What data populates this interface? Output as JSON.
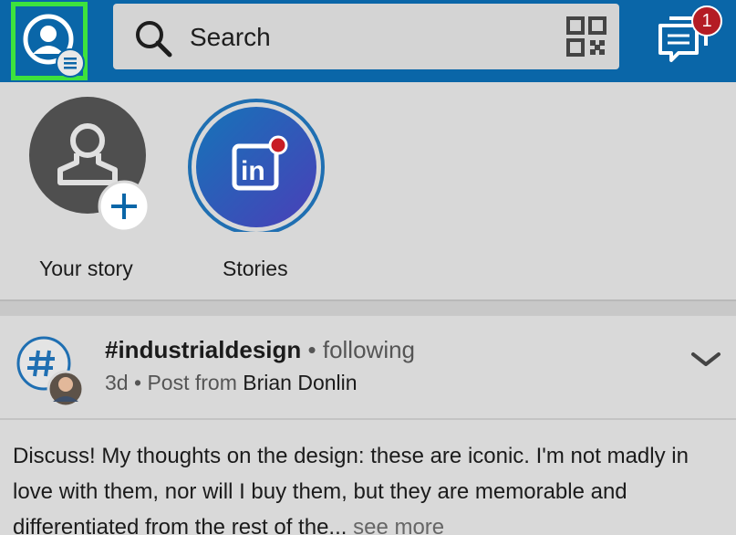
{
  "topbar": {
    "search_label": "Search",
    "messages_badge": "1",
    "colors": {
      "bar": "#0a66a8",
      "highlight": "#3de23d",
      "badge": "#b41c24"
    }
  },
  "stories": {
    "items": [
      {
        "label": "Your story"
      },
      {
        "label": "Stories"
      }
    ]
  },
  "post": {
    "hashtag": "#industrialdesign",
    "separator": "•",
    "follow_status": "following",
    "age": "3d",
    "source_prefix": "Post from",
    "author": "Brian Donlin",
    "body": "Discuss! My thoughts on the design: these are iconic. I'm not madly in love with them, nor will I buy them, but they are memorable and differentiated from the rest of the...",
    "see_more": "see more"
  }
}
